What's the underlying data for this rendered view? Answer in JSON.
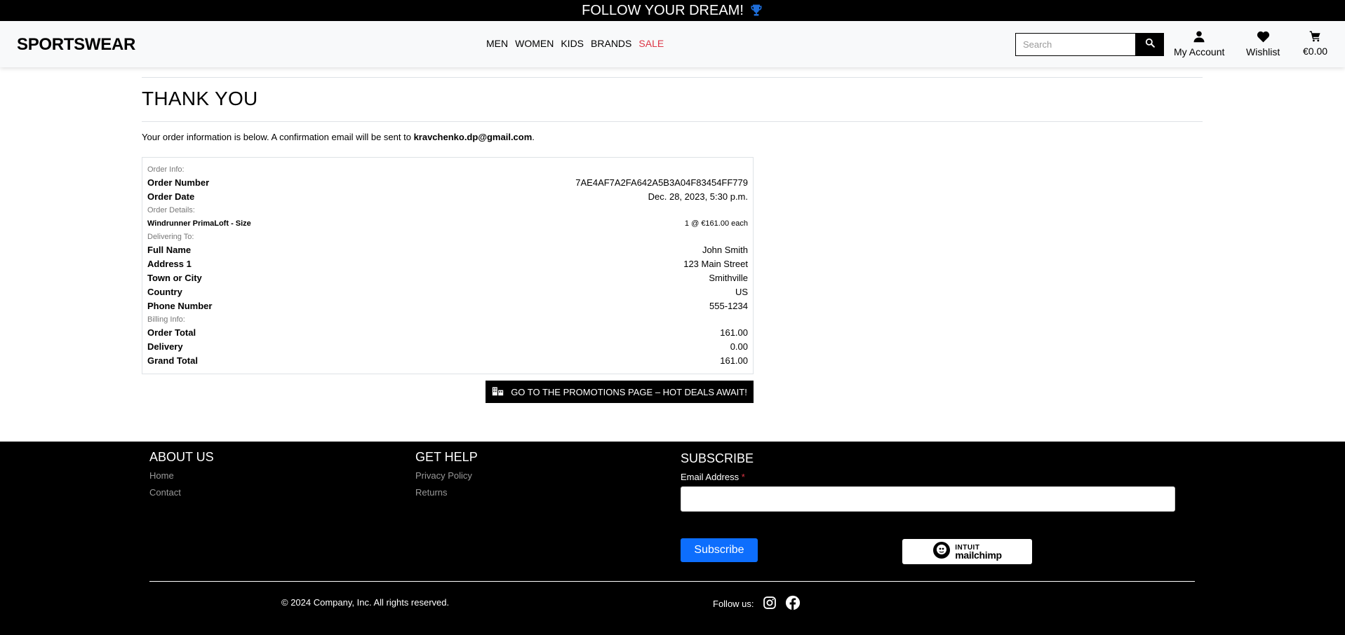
{
  "topbar": {
    "text": "FOLLOW YOUR DREAM!"
  },
  "header": {
    "brand": "SPORTSWEAR",
    "menu": [
      "MEN",
      "WOMEN",
      "KIDS",
      "BRANDS",
      "SALE"
    ],
    "search_placeholder": "Search",
    "account_label": "My Account",
    "wishlist_label": "Wishlist",
    "cart_total": "€0.00"
  },
  "main": {
    "title": "THANK YOU",
    "intro_prefix": "Your order information is below. A confirmation email will be sent to ",
    "email": "kravchenko.dp@gmail.com",
    "intro_suffix": "."
  },
  "order": {
    "order_info_label": "Order Info:",
    "order_number_label": "Order Number",
    "order_number": "7AE4AF7A2FA642A5B3A04F83454FF779",
    "order_date_label": "Order Date",
    "order_date": "Dec. 28, 2023, 5:30 p.m.",
    "order_details_label": "Order Details:",
    "item_name": "Windrunner PrimaLoft - Size",
    "item_qty_price": "1 @ €161.00 each",
    "delivering_label": "Delivering To:",
    "full_name_label": "Full Name",
    "full_name": "John Smith",
    "address1_label": "Address 1",
    "address1": "123 Main Street",
    "town_label": "Town or City",
    "town": "Smithville",
    "country_label": "Country",
    "country": "US",
    "phone_label": "Phone Number",
    "phone": "555-1234",
    "billing_label": "Billing Info:",
    "order_total_label": "Order Total",
    "order_total": "161.00",
    "delivery_label": "Delivery",
    "delivery": "0.00",
    "grand_total_label": "Grand Total",
    "grand_total": "161.00"
  },
  "promo_button": "GO TO THE PROMOTIONS PAGE – HOT DEALS AWAIT!",
  "footer": {
    "about_title": "ABOUT US",
    "about_links": [
      "Home",
      "Contact"
    ],
    "help_title": "GET HELP",
    "help_links": [
      "Privacy Policy",
      "Returns"
    ],
    "subscribe_title": "SUBSCRIBE",
    "email_label": "Email Address",
    "required_mark": "*",
    "subscribe_button": "Subscribe",
    "mailchimp_line1": "INTUIT",
    "mailchimp_line2": "mailchimp",
    "copyright": "© 2024 Company, Inc. All rights reserved.",
    "follow_label": "Follow us:"
  },
  "colors": {
    "sale": "#dc3545",
    "subscribe": "#0d6efd",
    "trophy": "#1e6dd8"
  },
  "icons": [
    "trophy-icon",
    "search-icon",
    "user-icon",
    "heart-icon",
    "cart-icon",
    "store-icon",
    "instagram-icon",
    "facebook-icon",
    "mailchimp-logo"
  ]
}
